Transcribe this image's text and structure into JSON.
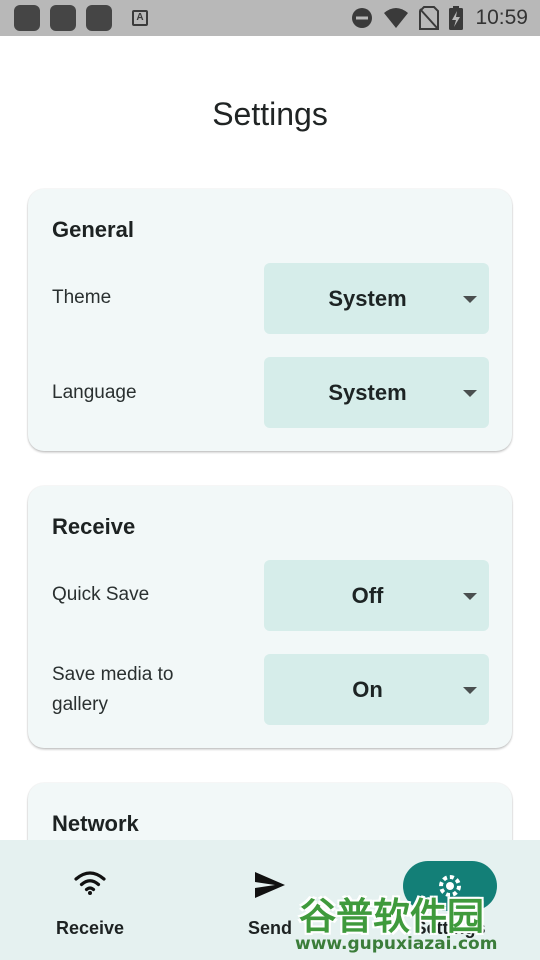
{
  "status_bar": {
    "time": "10:59",
    "icons": [
      "notification-square-icon",
      "notification-square-icon",
      "notification-square-icon",
      "a-box-icon",
      "do-not-disturb-icon",
      "wifi-icon",
      "no-sim-icon",
      "battery-charging-icon"
    ]
  },
  "page": {
    "title": "Settings"
  },
  "sections": [
    {
      "title": "General",
      "rows": [
        {
          "label": "Theme",
          "value": "System"
        },
        {
          "label": "Language",
          "value": "System"
        }
      ]
    },
    {
      "title": "Receive",
      "rows": [
        {
          "label": "Quick Save",
          "value": "Off"
        },
        {
          "label_lines": [
            "Save media to",
            "gallery"
          ],
          "value": "On"
        }
      ]
    },
    {
      "title": "Network",
      "rows": []
    }
  ],
  "bottom_nav": {
    "items": [
      {
        "label": "Receive",
        "icon": "wifi-icon"
      },
      {
        "label": "Send",
        "icon": "send-icon"
      },
      {
        "label": "Settings",
        "icon": "gear-icon",
        "selected": true
      }
    ]
  },
  "watermark": {
    "title": "谷普软件园",
    "url": "www.gupuxiazai.com"
  },
  "colors": {
    "accent": "#137f77",
    "card_background": "#f2f8f8",
    "dropdown_background": "#d6edea",
    "nav_background": "#e5f1f0",
    "status_bar": "#b8b8b8"
  }
}
